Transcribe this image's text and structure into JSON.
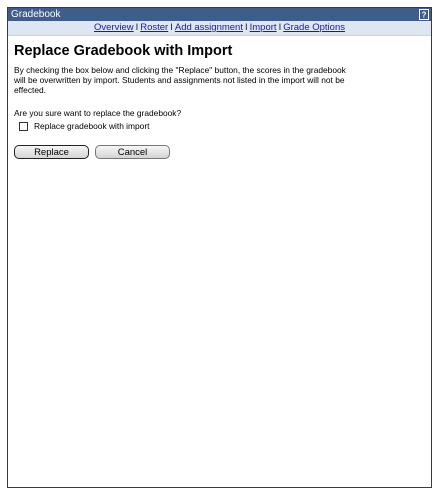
{
  "window": {
    "title": "Gradebook",
    "help_icon": "help-icon"
  },
  "nav": {
    "items": [
      "Overview",
      "Roster",
      "Add assignment",
      "Import",
      "Grade Options"
    ],
    "separator": "I"
  },
  "page": {
    "heading": "Replace Gradebook with Import",
    "description": "By checking the box below and clicking the \"Replace\" button, the scores in the gradebook will be overwritten by import. Students and assignments not listed in the import will not be effected.",
    "question": "Are you sure want to replace the gradebook?",
    "checkbox_label": "Replace gradebook with import",
    "checkbox_checked": false
  },
  "buttons": {
    "replace": "Replace",
    "cancel": "Cancel"
  },
  "colors": {
    "titlebar": "#3f5d8a",
    "navbar": "#dde6f2",
    "link": "#1a1aa6"
  }
}
